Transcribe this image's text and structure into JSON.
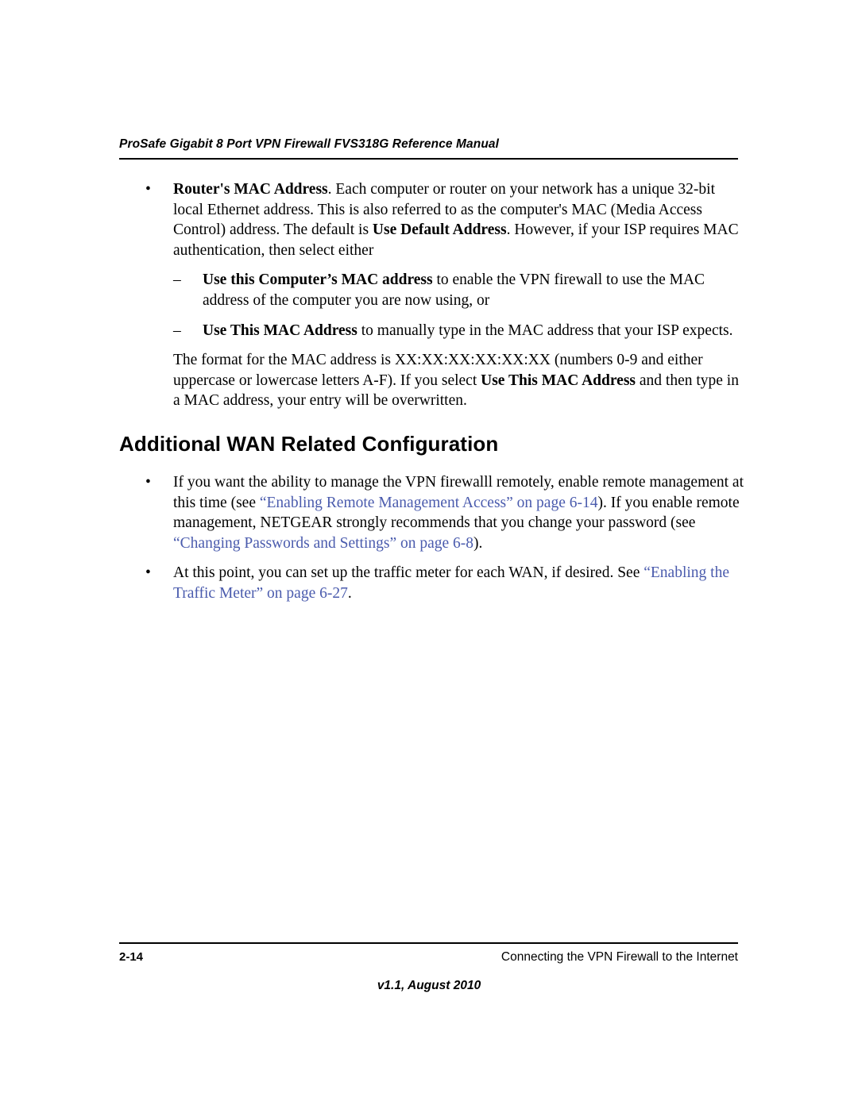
{
  "header": {
    "running_title": "ProSafe Gigabit 8 Port VPN Firewall FVS318G Reference Manual"
  },
  "body": {
    "bullet_mark": "•",
    "dash_mark": "–",
    "item1": {
      "lead_bold": "Router's MAC Address",
      "text": ". Each computer or router on your network has a unique 32-bit local Ethernet address. This is also referred to as the computer's MAC (Media Access Control) address. The default is ",
      "bold2": "Use Default Address",
      "text2": ". However, if your ISP requires MAC authentication, then select either"
    },
    "sub1": {
      "bold": "Use this Computer’s MAC address",
      "text": " to enable the VPN firewall to use the MAC address of the computer you are now using, or"
    },
    "sub2": {
      "bold": "Use This MAC Address",
      "text": " to manually type in the MAC address that your ISP expects."
    },
    "format_para": {
      "text1": "The format for the MAC address is XX:XX:XX:XX:XX:XX (numbers 0-9 and either uppercase or lowercase letters A-F). If you select ",
      "bold": "Use This MAC Address",
      "text2": " and then type in a MAC address, your entry will be overwritten."
    },
    "heading": "Additional WAN Related Configuration",
    "item2": {
      "text1": "If you want the ability to manage the VPN firewalll remotely, enable remote management at this time (see ",
      "link1": "“Enabling Remote Management Access” on page 6-14",
      "text2": "). If you enable remote management, NETGEAR strongly recommends that you change your password (see ",
      "link2": "“Changing Passwords and Settings” on page 6-8",
      "text3": ")."
    },
    "item3": {
      "text1": "At this point, you can set up the traffic meter for each WAN, if desired. See ",
      "link1": "“Enabling the Traffic Meter” on page 6-27",
      "text2": "."
    }
  },
  "footer": {
    "page_number": "2-14",
    "chapter_title": "Connecting the VPN Firewall to the Internet",
    "version": "v1.1, August 2010"
  },
  "colors": {
    "link": "#4a5bad",
    "text": "#000000",
    "background": "#ffffff"
  }
}
